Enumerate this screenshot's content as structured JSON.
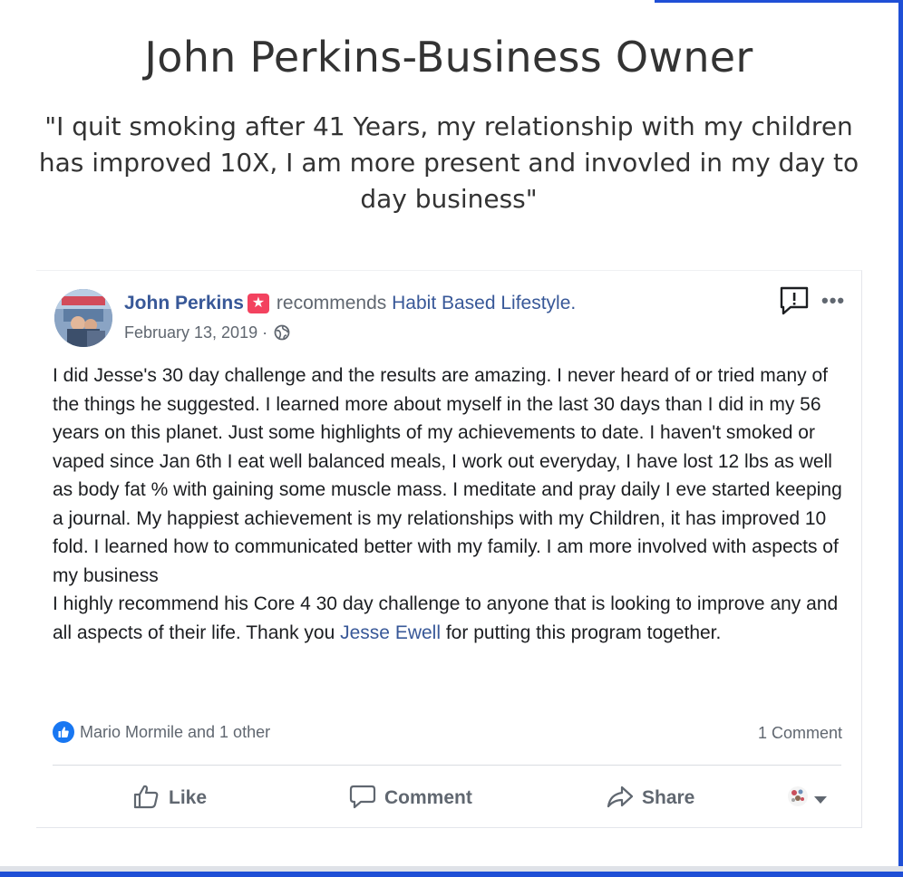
{
  "testimonial": {
    "headline": "John Perkins-Business Owner",
    "quote": "\"I quit smoking after 41 Years, my relationship with my children has improved 10X, I am more present and invovled in my day to day business\""
  },
  "post": {
    "author": "John Perkins",
    "action_text": "recommends",
    "page_name": "Habit Based Lifestyle.",
    "date": "February 13, 2019",
    "date_separator": "·",
    "body_paragraph_1": "I did Jesse's 30 day challenge and the results are amazing. I never heard of or tried many of the things he suggested. I learned more about myself in the last 30 days than I did in my 56 years on this planet. Just some highlights of my achievements to date. I haven't smoked or vaped since Jan 6th I eat well balanced meals, I work out everyday, I have lost 12 lbs as well as body fat % with gaining some muscle mass. I meditate and pray daily I eve started keeping a journal. My happiest achievement is my relationships with my Children, it has improved 10 fold. I learned how to communicated better with my family. I am more involved with aspects of my business",
    "body_paragraph_2_before": "I highly recommend his Core 4 30 day challenge to anyone that is looking to improve any and all aspects of their life. Thank you ",
    "body_mention": "Jesse Ewell",
    "body_paragraph_2_after": " for putting this program together.",
    "reactions_text": "Mario Mormile and 1 other",
    "comment_count": "1 Comment",
    "actions": {
      "like": "Like",
      "comment": "Comment",
      "share": "Share"
    },
    "icons": [
      "recommend-star-icon",
      "globe-icon",
      "report-icon",
      "more-icon",
      "like-reaction-icon",
      "thumbs-up-icon",
      "comment-bubble-icon",
      "share-arrow-icon",
      "caret-down-icon"
    ]
  },
  "colors": {
    "frame_accent": "#1f4fd6",
    "facebook_link": "#385898",
    "recommend_badge": "#f3425f",
    "like_blue": "#1877f2",
    "secondary_text": "#606770"
  }
}
